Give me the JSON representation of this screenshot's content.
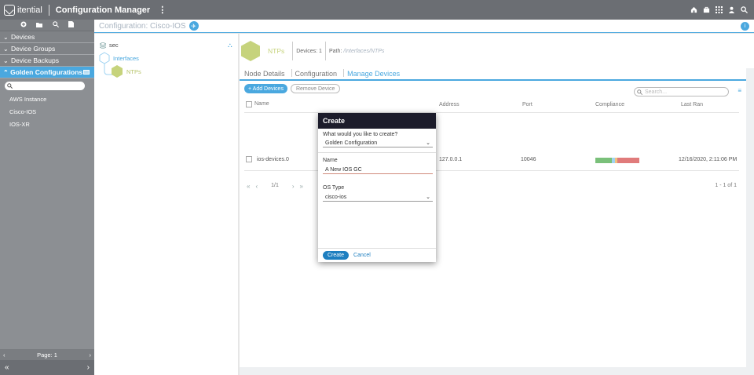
{
  "topbar": {
    "logo_text": "itential",
    "app_title": "Configuration Manager",
    "menu_glyph": "⋮",
    "icons": [
      "home-icon",
      "briefcase-icon",
      "apps-grid-icon",
      "user-icon",
      "search-icon"
    ]
  },
  "sidebar": {
    "tools": [
      "add-icon",
      "folder-icon",
      "search-icon",
      "document-icon"
    ],
    "sections": [
      {
        "label": "Devices"
      },
      {
        "label": "Device Groups"
      },
      {
        "label": "Device Backups"
      }
    ],
    "active_section": {
      "label": "Golden Configurations"
    },
    "items": [
      {
        "label": "AWS Instance"
      },
      {
        "label": "Cisco-IOS"
      },
      {
        "label": "IOS-XR"
      }
    ],
    "pager": {
      "label": "Page: 1",
      "prev": "‹",
      "next": "›"
    },
    "bottom": {
      "collapse": "«",
      "expand": "›"
    }
  },
  "header": {
    "breadcrumb": "Configuration: Cisco-IOS"
  },
  "tree": {
    "root": "sec",
    "child": "Interfaces",
    "leaf": "NTPs"
  },
  "node": {
    "name": "NTPs",
    "devices_label": "Devices:",
    "devices_count": "1",
    "path_label": "Path:",
    "path_value": "/Interfaces/NTPs"
  },
  "tabs": [
    {
      "label": "Node Details"
    },
    {
      "label": "Configuration"
    },
    {
      "label": "Manage Devices"
    }
  ],
  "actions": {
    "add_label": "+ Add Devices",
    "remove_label": "Remove Device",
    "search_placeholder": "Search..."
  },
  "table": {
    "columns": [
      "Name",
      "Address",
      "Port",
      "Compliance",
      "Last Ran"
    ],
    "rows": [
      {
        "name": "ios-devices.0",
        "address": "127.0.0.1",
        "port": "10046",
        "last_ran": "12/16/2020, 2:11:06 PM"
      }
    ],
    "compliance_colors": [
      "#7ac07a",
      "#9fd3f2",
      "#f0c080",
      "#e07b7b"
    ],
    "compliance_shares": [
      0.38,
      0.06,
      0.06,
      0.5
    ],
    "pager": {
      "first": "«",
      "prev": "‹",
      "page": "1/1",
      "next": "›",
      "last": "»"
    },
    "count": "1 - 1 of 1"
  },
  "modal": {
    "title": "Create",
    "question_label": "What would you like to create?",
    "question_value": "Golden Configuration",
    "name_label": "Name",
    "name_value": "A New IOS GC",
    "os_label": "OS Type",
    "os_value": "cisco-ios",
    "create_label": "Create",
    "cancel_label": "Cancel"
  },
  "colors": {
    "accent": "#4aa8df",
    "node": "#c6d37c",
    "topbar": "#6b6e73"
  }
}
